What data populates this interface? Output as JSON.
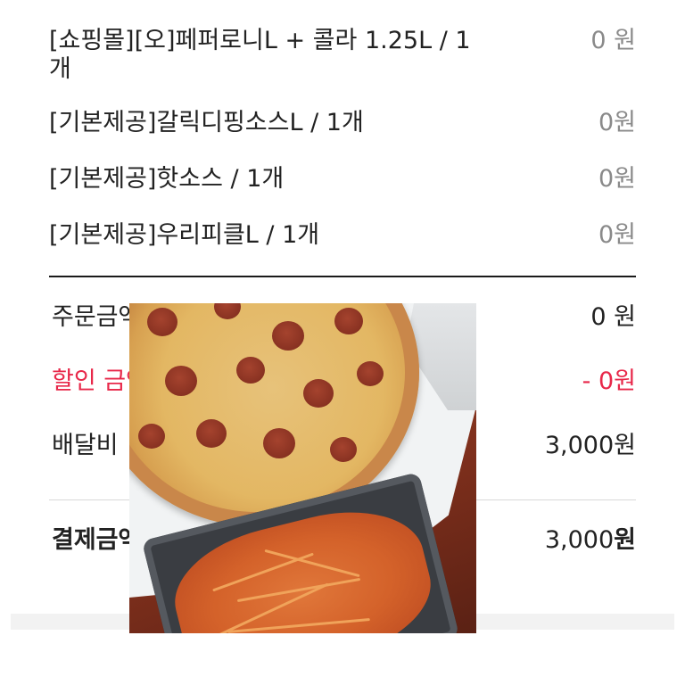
{
  "items": [
    {
      "name": "[쇼핑몰][오]페퍼로니L + 콜라 1.25L / 1개",
      "price": "0 원"
    },
    {
      "name": "[기본제공]갈릭디핑소스L / 1개",
      "price": "0원"
    },
    {
      "name": "[기본제공]핫소스 / 1개",
      "price": "0원"
    },
    {
      "name": "[기본제공]우리피클L / 1개",
      "price": "0원"
    }
  ],
  "summary": {
    "order_label": "주문금액",
    "order_value": "0 원",
    "discount_label": "할인 금액",
    "discount_value": "- 0원",
    "delivery_label": "배달비",
    "delivery_value": "3,000원",
    "total_label": "결제금액",
    "total_number": "3,000",
    "total_unit": "원"
  },
  "photo": {
    "subject": "pepperoni pizza and pasta photo"
  },
  "colors": {
    "discount": "#e8284a",
    "muted_price": "#8a8a8a"
  }
}
